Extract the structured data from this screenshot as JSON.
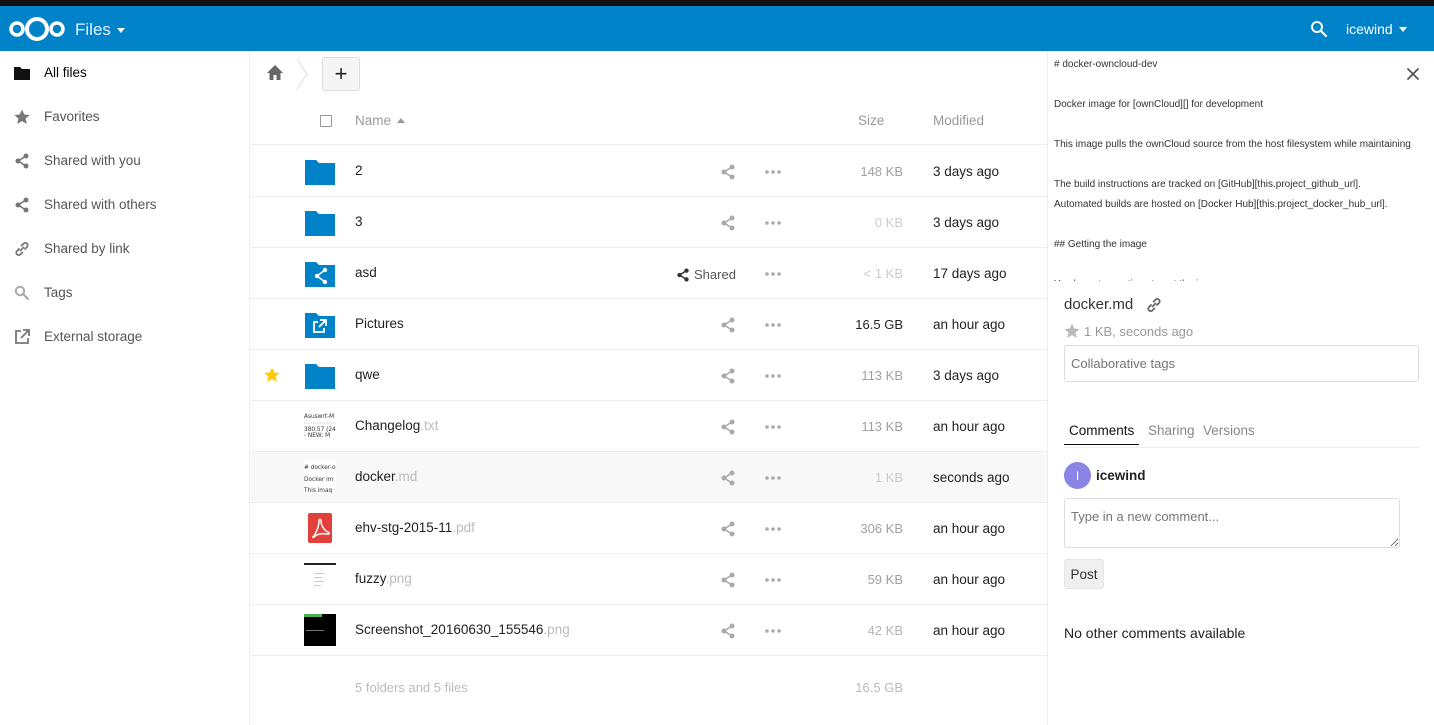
{
  "header": {
    "app_name": "Files",
    "user_name": "icewind",
    "brand_color": "#0082c9",
    "icons": [
      "nextcloud-logo-icon",
      "caret-down-icon",
      "search-icon",
      "caret-down-icon"
    ]
  },
  "sidebar": {
    "items": [
      {
        "label": "All files",
        "icon": "folder-icon",
        "active": true
      },
      {
        "label": "Favorites",
        "icon": "star-icon",
        "active": false
      },
      {
        "label": "Shared with you",
        "icon": "share-icon",
        "active": false
      },
      {
        "label": "Shared with others",
        "icon": "share-icon",
        "active": false
      },
      {
        "label": "Shared by link",
        "icon": "link-icon",
        "active": false
      },
      {
        "label": "Tags",
        "icon": "tag-search-icon",
        "active": false
      },
      {
        "label": "External storage",
        "icon": "external-icon",
        "active": false
      }
    ]
  },
  "controls": {
    "home_icon": "home-icon",
    "new_label": "+"
  },
  "table": {
    "headers": {
      "name": "Name",
      "size": "Size",
      "modified": "Modified"
    },
    "rows": [
      {
        "name": "2",
        "ext": "",
        "type": "folder",
        "size": "148 KB",
        "size_color": "#a0a0a0",
        "modified": "3 days ago",
        "favorite": false,
        "shared": false,
        "selected": false
      },
      {
        "name": "3",
        "ext": "",
        "type": "folder",
        "size": "0 KB",
        "size_color": "#cccccc",
        "modified": "3 days ago",
        "favorite": false,
        "shared": false,
        "selected": false
      },
      {
        "name": "asd",
        "ext": "",
        "type": "folder-shared",
        "size": "< 1 KB",
        "size_color": "#cccccc",
        "modified": "17 days ago",
        "favorite": false,
        "shared": true,
        "share_label": "Shared",
        "selected": false
      },
      {
        "name": "Pictures",
        "ext": "",
        "type": "folder-external",
        "size": "16.5 GB",
        "size_color": "#222222",
        "modified": "an hour ago",
        "favorite": false,
        "shared": false,
        "selected": false
      },
      {
        "name": "qwe",
        "ext": "",
        "type": "folder",
        "size": "113 KB",
        "size_color": "#a0a0a0",
        "modified": "3 days ago",
        "favorite": true,
        "shared": false,
        "selected": false
      },
      {
        "name": "Changelog",
        "ext": ".txt",
        "type": "text-thumb",
        "size": "113 KB",
        "size_color": "#a0a0a0",
        "modified": "an hour ago",
        "favorite": false,
        "shared": false,
        "selected": false
      },
      {
        "name": "docker",
        "ext": ".md",
        "type": "md-thumb",
        "size": "1 KB",
        "size_color": "#cccccc",
        "modified": "seconds ago",
        "favorite": false,
        "shared": false,
        "selected": true
      },
      {
        "name": "ehv-stg-2015-11",
        "ext": ".pdf",
        "type": "pdf",
        "size": "306 KB",
        "size_color": "#a0a0a0",
        "modified": "an hour ago",
        "favorite": false,
        "shared": false,
        "selected": false
      },
      {
        "name": "fuzzy",
        "ext": ".png",
        "type": "image-light",
        "size": "59 KB",
        "size_color": "#a0a0a0",
        "modified": "an hour ago",
        "favorite": false,
        "shared": false,
        "selected": false
      },
      {
        "name": "Screenshot_20160630_155546",
        "ext": ".png",
        "type": "image-dark",
        "size": "42 KB",
        "size_color": "#b5b5b5",
        "modified": "an hour ago",
        "favorite": false,
        "shared": false,
        "selected": false
      }
    ],
    "summary": {
      "counts": "5 folders and 5 files",
      "total_size": "16.5 GB"
    }
  },
  "thumb_text": {
    "changelog": [
      "Asuswrt-M",
      "380.57 (24",
      "- NEW: M"
    ],
    "docker": [
      "# docker-o",
      "Docker im",
      "This imag"
    ]
  },
  "panel": {
    "preview_lines": [
      "# docker-owncloud-dev",
      "",
      "Docker image for [ownCloud][] for development",
      "",
      "This image pulls the ownCloud source from the host filesystem while maintaining",
      "",
      "The build instructions are tracked on [GitHub][this.project_github_url].",
      "Automated builds are hosted on [Docker Hub][this.project_docker_hub_url].",
      "",
      "## Getting the image",
      "",
      "You have two options to get the image:"
    ],
    "file_name": "docker.md",
    "meta": "1 KB, seconds ago",
    "tags_placeholder": "Collaborative tags",
    "tabs": [
      "Comments",
      "Sharing",
      "Versions"
    ],
    "comment_user": "icewind",
    "avatar_letter": "I",
    "comment_placeholder": "Type in a new comment...",
    "post_label": "Post",
    "no_comments": "No other comments available"
  }
}
